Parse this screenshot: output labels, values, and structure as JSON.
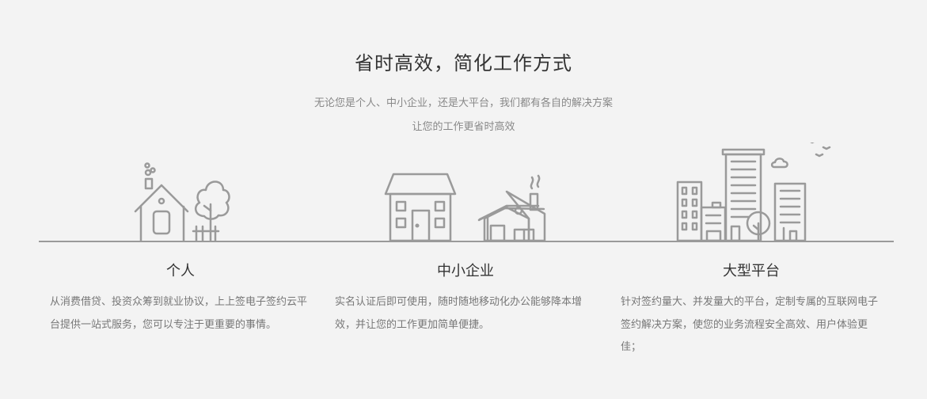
{
  "heading": "省时高效，简化工作方式",
  "subtitle_line1": "无论您是个人、中小企业，还是大平台，我们都有各自的解决方案",
  "subtitle_line2": "让您的工作更省时高效",
  "columns": [
    {
      "title": "个人",
      "description": "从消费借贷、投资众筹到就业协议，上上签电子签约云平台提供一站式服务，您可以专注于更重要的事情。",
      "illustration_icon": "house-icon"
    },
    {
      "title": "中小企业",
      "description": "实名认证后即可使用，随时随地移动化办公能够降本增效，并让您的工作更加简单便捷。",
      "illustration_icon": "shop-icon"
    },
    {
      "title": "大型平台",
      "description": "针对签约量大、并发量大的平台，定制专属的互联网电子签约解决方案，使您的业务流程安全高效、用户体验更佳；",
      "illustration_icon": "city-buildings-icon"
    }
  ],
  "colors": {
    "background": "#f3f3f3",
    "line_art": "#9a9a9a",
    "heading": "#333333",
    "body_text": "#777777"
  }
}
